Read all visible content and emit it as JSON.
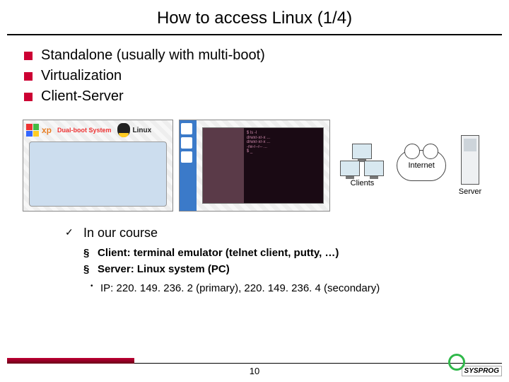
{
  "title": "How to access Linux (1/4)",
  "bullets": [
    "Standalone (usually with multi-boot)",
    "Virtualization",
    "Client-Server"
  ],
  "images": {
    "standalone": {
      "xp_label": "xp",
      "dualboot_label": "Dual-boot System",
      "linux_label": "Linux"
    },
    "client_server": {
      "clients_label": "Clients",
      "internet_label": "Internet",
      "server_label": "Server"
    }
  },
  "sub": {
    "course_heading": "In our course",
    "items": [
      "Client: terminal emulator (telnet client, putty, …)",
      "Server: Linux system (PC)"
    ],
    "ip_line": "IP: 220. 149. 236. 2 (primary), 220. 149. 236. 4 (secondary)"
  },
  "footer": {
    "page": "10",
    "logo": "SYSPROG"
  }
}
